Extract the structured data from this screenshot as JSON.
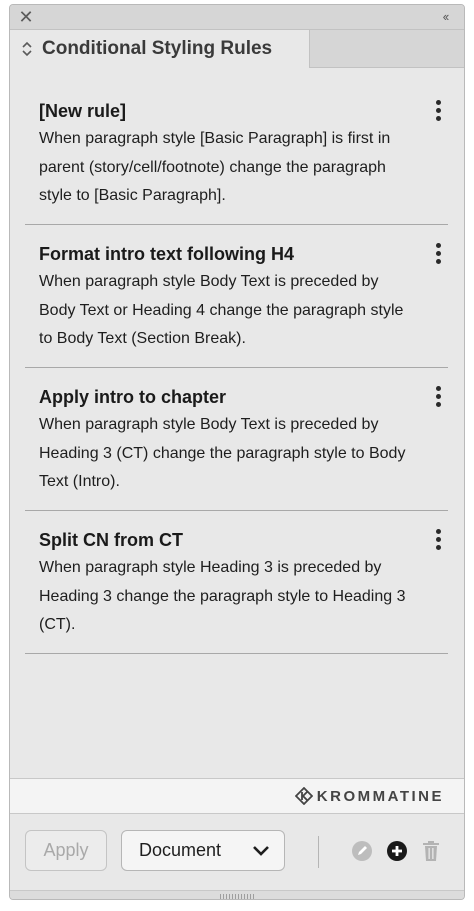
{
  "panel": {
    "close_glyph": "✕",
    "collapse_glyph": "‹‹",
    "tab_title": "Conditional Styling Rules"
  },
  "rules": [
    {
      "title": "[New rule]",
      "description": "When paragraph style [Basic Paragraph] is first in parent (story/cell/footnote) change the paragraph style to [Basic Paragraph]."
    },
    {
      "title": "Format intro text following H4",
      "description": "When paragraph style Body Text is preceded by Body Text or Heading 4 change the paragraph style to Body Text (Section Break)."
    },
    {
      "title": "Apply intro to chapter",
      "description": "When paragraph style Body Text is preceded by Heading 3 (CT) change the paragraph style to Body Text (Intro)."
    },
    {
      "title": "Split CN from CT",
      "description": "When paragraph style Heading 3 is preceded by Heading 3 change the paragraph style to Heading 3 (CT)."
    }
  ],
  "brand": {
    "name": "KROMMATINE"
  },
  "footer": {
    "apply_label": "Apply",
    "scope_selected": "Document",
    "icons": [
      "edit-disabled-icon",
      "add-circle-icon",
      "trash-icon"
    ]
  },
  "colors": {
    "panel_bg": "#e8e8e8",
    "header_bg": "#d6d6d6",
    "text": "#1e1e1e",
    "disabled": "#a9a9a9"
  }
}
